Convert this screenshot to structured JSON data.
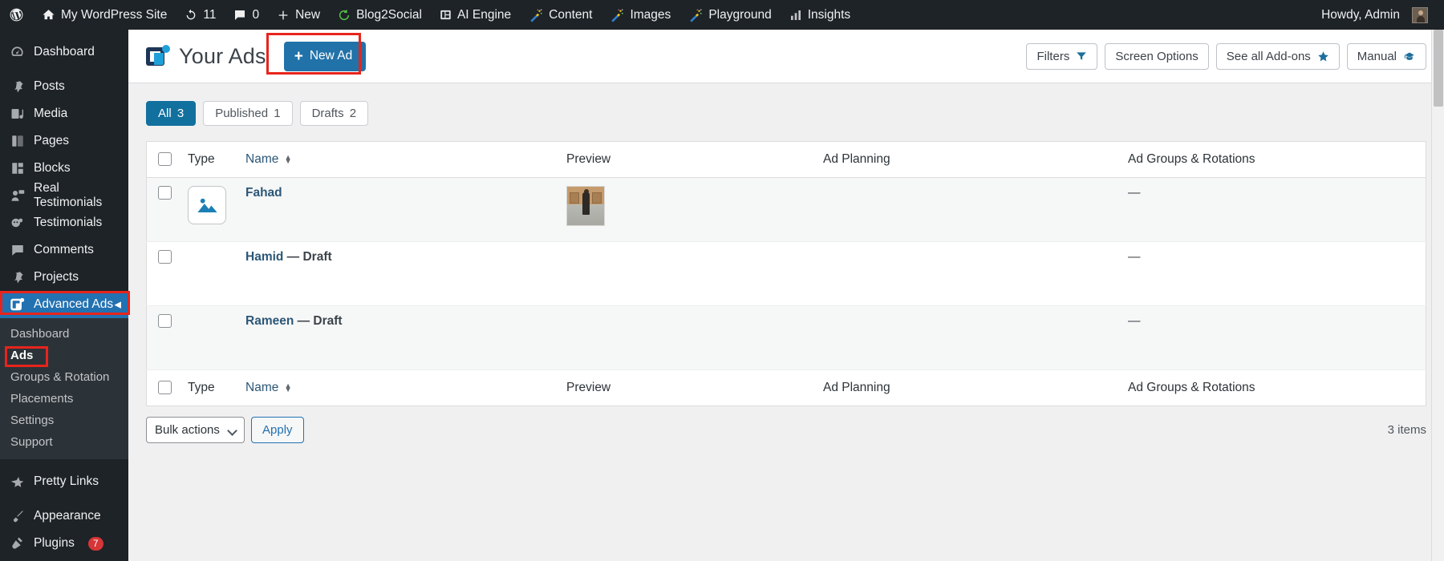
{
  "adminbar": {
    "site_name": "My WordPress Site",
    "updates_count": "11",
    "comments_count": "0",
    "new_label": "New",
    "items": [
      {
        "label": "Blog2Social",
        "icon": "blog2social-icon"
      },
      {
        "label": "AI Engine",
        "icon": "ai-engine-icon"
      },
      {
        "label": "Content",
        "icon": "magic-wand-icon"
      },
      {
        "label": "Images",
        "icon": "magic-wand-icon"
      },
      {
        "label": "Playground",
        "icon": "magic-wand-icon"
      },
      {
        "label": "Insights",
        "icon": "bar-chart-icon"
      }
    ],
    "howdy": "Howdy, Admin"
  },
  "sidebar": {
    "items": [
      {
        "label": "Dashboard",
        "icon": "dashboard-icon",
        "badge": ""
      },
      {
        "label": "Posts",
        "icon": "pin-icon",
        "badge": ""
      },
      {
        "label": "Media",
        "icon": "media-icon",
        "badge": ""
      },
      {
        "label": "Pages",
        "icon": "pages-icon",
        "badge": ""
      },
      {
        "label": "Blocks",
        "icon": "blocks-icon",
        "badge": ""
      },
      {
        "label": "Real Testimonials",
        "icon": "user-comment-icon",
        "badge": ""
      },
      {
        "label": "Testimonials",
        "icon": "testimonials-icon",
        "badge": ""
      },
      {
        "label": "Comments",
        "icon": "comment-icon",
        "badge": ""
      },
      {
        "label": "Projects",
        "icon": "pin-icon",
        "badge": ""
      },
      {
        "label": "Advanced Ads",
        "icon": "advanced-ads-icon",
        "badge": "",
        "current": true
      }
    ],
    "submenu": [
      {
        "label": "Dashboard"
      },
      {
        "label": "Ads",
        "current": true
      },
      {
        "label": "Groups & Rotation"
      },
      {
        "label": "Placements"
      },
      {
        "label": "Settings"
      },
      {
        "label": "Support"
      }
    ],
    "bottom_items": [
      {
        "label": "Pretty Links",
        "icon": "pretty-links-icon",
        "badge": ""
      },
      {
        "label": "Appearance",
        "icon": "brush-icon",
        "badge": ""
      },
      {
        "label": "Plugins",
        "icon": "plug-icon",
        "badge": "7"
      }
    ]
  },
  "header": {
    "title": "Your Ads",
    "new_ad_label": "New Ad",
    "buttons": [
      {
        "label": "Filters",
        "icon": "funnel-icon"
      },
      {
        "label": "Screen Options",
        "icon": ""
      },
      {
        "label": "See all Add-ons",
        "icon": "star-icon"
      },
      {
        "label": "Manual",
        "icon": "graduation-cap-icon"
      }
    ]
  },
  "status_tabs": [
    {
      "label": "All",
      "count": "3",
      "active": true
    },
    {
      "label": "Published",
      "count": "1",
      "active": false
    },
    {
      "label": "Drafts",
      "count": "2",
      "active": false
    }
  ],
  "table": {
    "columns": [
      "Type",
      "Name",
      "Preview",
      "Ad Planning",
      "Ad Groups & Rotations"
    ],
    "rows": [
      {
        "name": "Fahad",
        "suffix": "",
        "type_icon": "image-placeholder-icon",
        "has_preview": true,
        "planning": "",
        "groups": "—"
      },
      {
        "name": "Hamid",
        "suffix": " — Draft",
        "type_icon": "",
        "has_preview": false,
        "planning": "",
        "groups": "—"
      },
      {
        "name": "Rameen",
        "suffix": " — Draft",
        "type_icon": "",
        "has_preview": false,
        "planning": "",
        "groups": "—"
      }
    ]
  },
  "footer": {
    "bulk_actions_label": "Bulk actions",
    "apply_label": "Apply",
    "items_count": "3 items"
  },
  "colors": {
    "accent": "#2271b1",
    "admin_bg": "#1d2327",
    "brand_blue": "#1fa0d8",
    "highlight_red": "#e8241c",
    "tab_active": "#12709e"
  }
}
